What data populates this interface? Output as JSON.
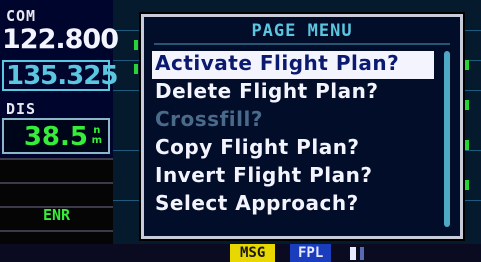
{
  "com": {
    "label": "COM",
    "active": "122.800",
    "standby": "135.325"
  },
  "dis": {
    "label": "DIS",
    "value": "38.5",
    "unit_top": "n",
    "unit_bottom": "m"
  },
  "mode": {
    "label": "ENR"
  },
  "menu": {
    "title": "PAGE MENU",
    "items": [
      {
        "label": "Activate Flight Plan?",
        "state": "selected"
      },
      {
        "label": "Delete Flight Plan?",
        "state": "normal"
      },
      {
        "label": "Crossfill?",
        "state": "disabled"
      },
      {
        "label": "Copy Flight Plan?",
        "state": "normal"
      },
      {
        "label": "Invert Flight Plan?",
        "state": "normal"
      },
      {
        "label": "Select Approach?",
        "state": "normal"
      }
    ]
  },
  "status": {
    "msg": "MSG",
    "page": "FPL"
  },
  "colors": {
    "cyan": "#5cc6e0",
    "green": "#36ee3a",
    "highlight": "#f4f4ff",
    "msg": "#e9d800",
    "page": "#1a3dbd"
  }
}
